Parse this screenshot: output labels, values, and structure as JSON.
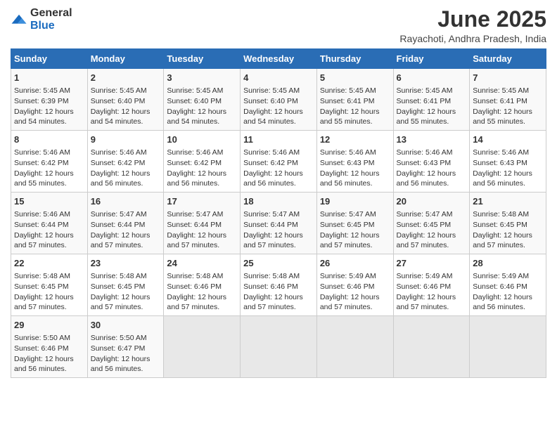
{
  "logo": {
    "general": "General",
    "blue": "Blue"
  },
  "title": "June 2025",
  "subtitle": "Rayachoti, Andhra Pradesh, India",
  "headers": [
    "Sunday",
    "Monday",
    "Tuesday",
    "Wednesday",
    "Thursday",
    "Friday",
    "Saturday"
  ],
  "weeks": [
    [
      {
        "day": "1",
        "info": "Sunrise: 5:45 AM\nSunset: 6:39 PM\nDaylight: 12 hours\nand 54 minutes."
      },
      {
        "day": "2",
        "info": "Sunrise: 5:45 AM\nSunset: 6:40 PM\nDaylight: 12 hours\nand 54 minutes."
      },
      {
        "day": "3",
        "info": "Sunrise: 5:45 AM\nSunset: 6:40 PM\nDaylight: 12 hours\nand 54 minutes."
      },
      {
        "day": "4",
        "info": "Sunrise: 5:45 AM\nSunset: 6:40 PM\nDaylight: 12 hours\nand 54 minutes."
      },
      {
        "day": "5",
        "info": "Sunrise: 5:45 AM\nSunset: 6:41 PM\nDaylight: 12 hours\nand 55 minutes."
      },
      {
        "day": "6",
        "info": "Sunrise: 5:45 AM\nSunset: 6:41 PM\nDaylight: 12 hours\nand 55 minutes."
      },
      {
        "day": "7",
        "info": "Sunrise: 5:45 AM\nSunset: 6:41 PM\nDaylight: 12 hours\nand 55 minutes."
      }
    ],
    [
      {
        "day": "8",
        "info": "Sunrise: 5:46 AM\nSunset: 6:42 PM\nDaylight: 12 hours\nand 55 minutes."
      },
      {
        "day": "9",
        "info": "Sunrise: 5:46 AM\nSunset: 6:42 PM\nDaylight: 12 hours\nand 56 minutes."
      },
      {
        "day": "10",
        "info": "Sunrise: 5:46 AM\nSunset: 6:42 PM\nDaylight: 12 hours\nand 56 minutes."
      },
      {
        "day": "11",
        "info": "Sunrise: 5:46 AM\nSunset: 6:42 PM\nDaylight: 12 hours\nand 56 minutes."
      },
      {
        "day": "12",
        "info": "Sunrise: 5:46 AM\nSunset: 6:43 PM\nDaylight: 12 hours\nand 56 minutes."
      },
      {
        "day": "13",
        "info": "Sunrise: 5:46 AM\nSunset: 6:43 PM\nDaylight: 12 hours\nand 56 minutes."
      },
      {
        "day": "14",
        "info": "Sunrise: 5:46 AM\nSunset: 6:43 PM\nDaylight: 12 hours\nand 56 minutes."
      }
    ],
    [
      {
        "day": "15",
        "info": "Sunrise: 5:46 AM\nSunset: 6:44 PM\nDaylight: 12 hours\nand 57 minutes."
      },
      {
        "day": "16",
        "info": "Sunrise: 5:47 AM\nSunset: 6:44 PM\nDaylight: 12 hours\nand 57 minutes."
      },
      {
        "day": "17",
        "info": "Sunrise: 5:47 AM\nSunset: 6:44 PM\nDaylight: 12 hours\nand 57 minutes."
      },
      {
        "day": "18",
        "info": "Sunrise: 5:47 AM\nSunset: 6:44 PM\nDaylight: 12 hours\nand 57 minutes."
      },
      {
        "day": "19",
        "info": "Sunrise: 5:47 AM\nSunset: 6:45 PM\nDaylight: 12 hours\nand 57 minutes."
      },
      {
        "day": "20",
        "info": "Sunrise: 5:47 AM\nSunset: 6:45 PM\nDaylight: 12 hours\nand 57 minutes."
      },
      {
        "day": "21",
        "info": "Sunrise: 5:48 AM\nSunset: 6:45 PM\nDaylight: 12 hours\nand 57 minutes."
      }
    ],
    [
      {
        "day": "22",
        "info": "Sunrise: 5:48 AM\nSunset: 6:45 PM\nDaylight: 12 hours\nand 57 minutes."
      },
      {
        "day": "23",
        "info": "Sunrise: 5:48 AM\nSunset: 6:45 PM\nDaylight: 12 hours\nand 57 minutes."
      },
      {
        "day": "24",
        "info": "Sunrise: 5:48 AM\nSunset: 6:46 PM\nDaylight: 12 hours\nand 57 minutes."
      },
      {
        "day": "25",
        "info": "Sunrise: 5:48 AM\nSunset: 6:46 PM\nDaylight: 12 hours\nand 57 minutes."
      },
      {
        "day": "26",
        "info": "Sunrise: 5:49 AM\nSunset: 6:46 PM\nDaylight: 12 hours\nand 57 minutes."
      },
      {
        "day": "27",
        "info": "Sunrise: 5:49 AM\nSunset: 6:46 PM\nDaylight: 12 hours\nand 57 minutes."
      },
      {
        "day": "28",
        "info": "Sunrise: 5:49 AM\nSunset: 6:46 PM\nDaylight: 12 hours\nand 56 minutes."
      }
    ],
    [
      {
        "day": "29",
        "info": "Sunrise: 5:50 AM\nSunset: 6:46 PM\nDaylight: 12 hours\nand 56 minutes."
      },
      {
        "day": "30",
        "info": "Sunrise: 5:50 AM\nSunset: 6:47 PM\nDaylight: 12 hours\nand 56 minutes."
      },
      {
        "day": "",
        "info": ""
      },
      {
        "day": "",
        "info": ""
      },
      {
        "day": "",
        "info": ""
      },
      {
        "day": "",
        "info": ""
      },
      {
        "day": "",
        "info": ""
      }
    ]
  ]
}
